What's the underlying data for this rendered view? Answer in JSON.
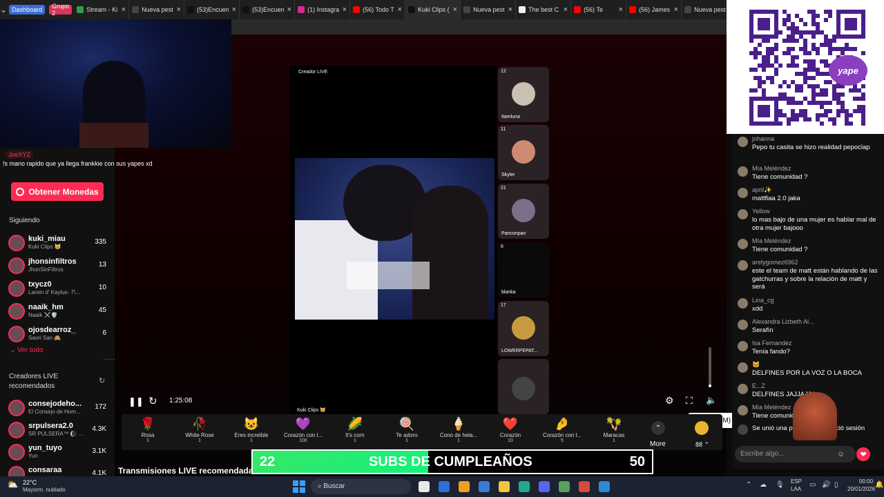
{
  "browser": {
    "groups": [
      {
        "label": "Dashboard",
        "color": "#3b6fd8"
      },
      {
        "label": "Grupo 2",
        "color": "#d8365a"
      }
    ],
    "tabs": [
      {
        "title": "Stream - Ki",
        "favicon": "#2e9e4e"
      },
      {
        "title": "Nueva pest",
        "favicon": "#444444"
      },
      {
        "title": "(53)Encuen",
        "favicon": "#111111"
      },
      {
        "title": "(53)Encuen",
        "favicon": "#111111"
      },
      {
        "title": "(1) Instagra",
        "favicon": "#d6298a"
      },
      {
        "title": "(56) Todo T",
        "favicon": "#ff0000"
      },
      {
        "title": "Kuki Clips (",
        "favicon": "#111111"
      },
      {
        "title": "Nueva pest",
        "favicon": "#444444"
      },
      {
        "title": "The best C",
        "favicon": "#eeeeee"
      },
      {
        "title": "(56) Te",
        "favicon": "#ff0000"
      },
      {
        "title": "(56) James",
        "favicon": "#ff0000"
      },
      {
        "title": "Nueva pest",
        "favicon": "#444444"
      }
    ]
  },
  "overlay": {
    "chat_user": "JoeXYZ",
    "chat_line": "!s mano rapido que ya llega frankkie con sus yapes xd"
  },
  "sidebar": {
    "coins_label": "Obtener Monedas",
    "following_title": "Siguiendo",
    "following": [
      {
        "name": "kuki_miau",
        "sub": "Kuki Clips 😸",
        "count": "335"
      },
      {
        "name": "jhonsinfiltros",
        "sub": "JhonSinFiltros",
        "count": "13"
      },
      {
        "name": "txycz0",
        "sub": "Larein d' Kaylus- 7\\...",
        "count": "10"
      },
      {
        "name": "naaik_hm",
        "sub": "Naaik ⚔️🛡️",
        "count": "45"
      },
      {
        "name": "ojosdearroz_",
        "sub": "Saori San 🙈",
        "count": "6"
      }
    ],
    "see_all": "Ver todo",
    "recommended_title": "Creadores LIVE recomendados",
    "recommended": [
      {
        "name": "consejodeho...",
        "sub": "El Consejo de Hom...",
        "count": "172"
      },
      {
        "name": "srpulsera2.0",
        "sub": "SR PULSERA™ 🌘 ...",
        "count": "4.3K"
      },
      {
        "name": "yun_tuyo",
        "sub": "Yun",
        "count": "3.1K"
      },
      {
        "name": "consaraa",
        "sub": "",
        "count": "4.1K"
      }
    ]
  },
  "stream": {
    "creator_label": "Creador LIVE",
    "host_label": "Kuki Clips 😸",
    "time": "1:25:08",
    "guests": [
      {
        "count": "12",
        "name": "Itamluna",
        "bg": "#c9bfb3"
      },
      {
        "count": "11",
        "name": "Skyler",
        "bg": "#d08a72"
      },
      {
        "count": "21",
        "name": "Panconpan",
        "bg": "#7a7088"
      },
      {
        "count": "6",
        "name": "blanka",
        "bg": "#0a0a0a"
      },
      {
        "count": "17",
        "name": "LOWERPEPAT...",
        "bg": "#c89a40"
      },
      {
        "count": "",
        "name": "",
        "bg": "#1e1e1e"
      }
    ],
    "mute_tooltip": "Silenciar (M)",
    "gifts": [
      {
        "name": "Rosa",
        "price": "1",
        "icon": "🌹"
      },
      {
        "name": "White Rose",
        "price": "1",
        "icon": "🥀"
      },
      {
        "name": "Eres increíble",
        "price": "1",
        "icon": "😺"
      },
      {
        "name": "Corazón con l...",
        "price": "100",
        "icon": "💜"
      },
      {
        "name": "It's corn",
        "price": "1",
        "icon": "🌽"
      },
      {
        "name": "Te adoro",
        "price": "1",
        "icon": "🍭"
      },
      {
        "name": "Cono de hela...",
        "price": "1",
        "icon": "🍦"
      },
      {
        "name": "Corazón",
        "price": "10",
        "icon": "❤️"
      },
      {
        "name": "Corazón con l...",
        "price": "5",
        "icon": "🤌"
      },
      {
        "name": "Maracas",
        "price": "1",
        "icon": "🪇"
      }
    ],
    "more_label": "More",
    "coin_balance": "88",
    "subs_current": "22",
    "subs_title": "SUBS DE CUMPLEAÑOS",
    "subs_goal": "50",
    "subs_progress": 0.44,
    "recommended_header": "Transmisiones LIVE recomendada"
  },
  "qr": {
    "brand": "yape"
  },
  "chat": {
    "messages": [
      {
        "user": "johanna",
        "text": "Pepo tu casita se hizo realidad pepoclap"
      },
      {
        "user": "Mía Meléndez",
        "text": "Tiene comunidad ?"
      },
      {
        "user": "april✨",
        "text": "mattfiaa 2.0 jaka"
      },
      {
        "user": "Yellow",
        "text": "lo mas bajo de una mujer es hablar mal de otra mujer bajooo"
      },
      {
        "user": "Mía Meléndez",
        "text": "Tiene comunidad ?"
      },
      {
        "user": "arelygomez6962",
        "text": "este el team de matt están hablando de las gatchurras y sobre la relación de matt y será"
      },
      {
        "user": "Lina_cg",
        "text": "xdd"
      },
      {
        "user": "Alexandra Lizbeth Al...",
        "text": "Serafín"
      },
      {
        "user": "Isa Fernandez",
        "text": "Tenía fando?"
      },
      {
        "user": "🐱",
        "text": "DELFINES POR LA VOZ O LA BOCA"
      },
      {
        "user": "E...Z",
        "text": "DELFINES JAJJAJJA"
      },
      {
        "user": "Mía Meléndez",
        "text": "Tiene comunidad"
      },
      {
        "user": "",
        "text": "Se unió una persona... no inició sesión"
      }
    ],
    "input_placeholder": "Escribe algo..."
  },
  "taskbar": {
    "weather_temp": "22°C",
    "weather_desc": "Mayorm. nublado",
    "search_label": "Buscar",
    "lang": "ESP",
    "lang_sub": "LAA",
    "time": "00:00",
    "date": "20/01/2026"
  }
}
